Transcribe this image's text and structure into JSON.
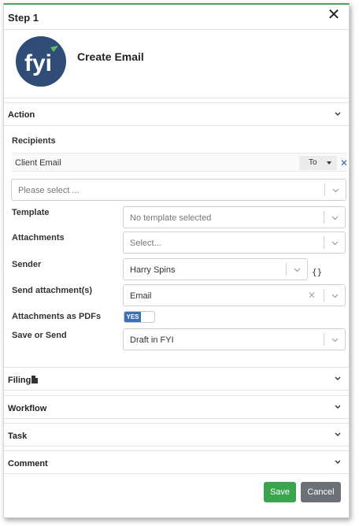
{
  "header": {
    "title": "Step 1"
  },
  "email": {
    "title": "Create Email",
    "logo_text": "fyi"
  },
  "action": {
    "section_title": "Action",
    "recipients_label": "Recipients",
    "recipient": {
      "name": "Client Email",
      "type": "To"
    },
    "recipient_select_placeholder": "Please select ...",
    "template": {
      "label": "Template",
      "placeholder": "No template selected"
    },
    "attachments": {
      "label": "Attachments",
      "placeholder": "Select..."
    },
    "sender": {
      "label": "Sender",
      "value": "Harry Spins",
      "braces": "{}"
    },
    "send_attachments": {
      "label": "Send attachment(s)",
      "value": "Email"
    },
    "attachments_pdf": {
      "label": "Attachments as PDFs",
      "toggle": "YES"
    },
    "save_or_send": {
      "label": "Save or Send",
      "value": "Draft in FYI"
    }
  },
  "sections": {
    "filing": "Filing",
    "workflow": "Workflow",
    "task": "Task",
    "comment": "Comment"
  },
  "buttons": {
    "save": "Save",
    "cancel": "Cancel"
  },
  "colors": {
    "accent": "#49a55a",
    "save": "#3aa54d",
    "cancel": "#6b7177",
    "logo_bg": "#2f4d77",
    "toggle_on": "#3d6fb6"
  }
}
